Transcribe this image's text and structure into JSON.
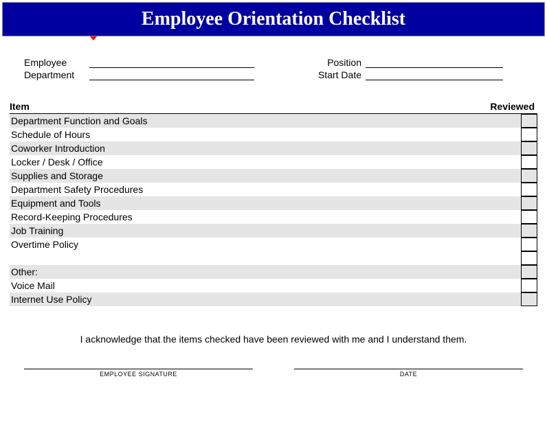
{
  "title": "Employee Orientation Checklist",
  "info": {
    "employee_label": "Employee",
    "department_label": "Department",
    "position_label": "Position",
    "start_date_label": "Start Date"
  },
  "columns": {
    "item": "Item",
    "reviewed": "Reviewed"
  },
  "items": [
    "Department Function and Goals",
    "Schedule of Hours",
    "Coworker Introduction",
    "Locker / Desk / Office",
    "Supplies and Storage",
    "Department Safety Procedures",
    "Equipment and Tools",
    "Record-Keeping Procedures",
    "Job Training",
    "Overtime Policy"
  ],
  "other_label": "Other:",
  "other_items": [
    "Voice Mail",
    "Internet Use Policy"
  ],
  "acknowledge": "I acknowledge that the items checked have been reviewed with me and I understand them.",
  "signature": {
    "employee": "EMPLOYEE SIGNATURE",
    "date": "DATE"
  }
}
